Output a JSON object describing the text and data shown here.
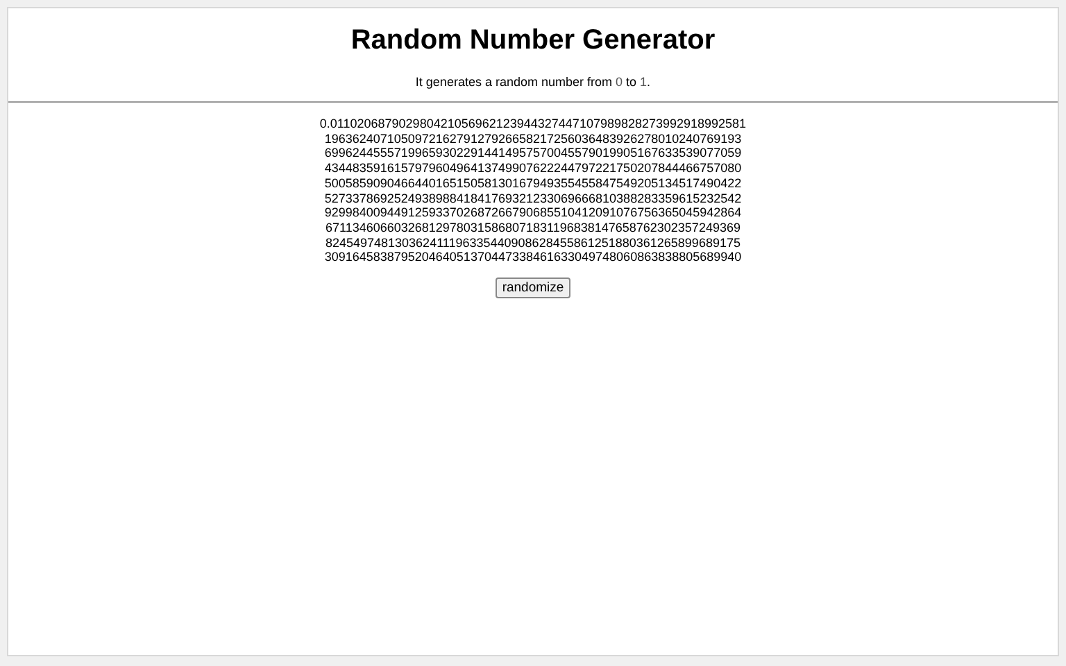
{
  "title": "Random Number Generator",
  "subtitle": {
    "before": "It generates a random number from ",
    "min": "0",
    "middle": " to ",
    "max": "1",
    "after": "."
  },
  "number_lines": [
    "0.011020687902980421056962123944327447107989828273992918992581",
    "196362407105097216279127926658217256036483926278010240769193",
    "699624455571996593022914414957570045579019905167633539077059",
    "434483591615797960496413749907622244797221750207844466757080",
    "500585909046644016515058130167949355455847549205134517490422",
    "527337869252493898841841769321233069666810388283359615232542",
    "929984009449125933702687266790685510412091076756365045942864",
    "671134606603268129780315868071831196838147658762302357249369",
    "824549748130362411196335440908628455861251880361265899689175",
    "309164583879520464051370447338461633049748060863838805689940"
  ],
  "button": "randomize"
}
